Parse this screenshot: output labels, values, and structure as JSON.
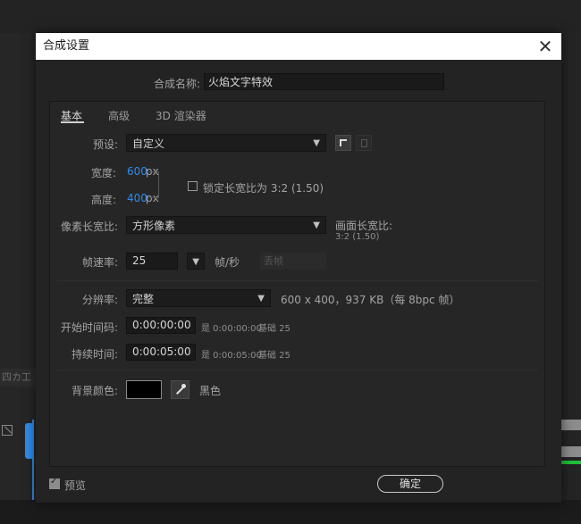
{
  "background": {
    "left_label": "四カ工"
  },
  "dialog": {
    "title": "合成设置",
    "close_glyph": "✕",
    "comp_name_label": "合成名称:",
    "comp_name_value": "火焰文字特效",
    "tabs": [
      "基本",
      "高级",
      "3D 渲染器"
    ],
    "preset": {
      "label": "预设:",
      "value": "自定义"
    },
    "width": {
      "label": "宽度:",
      "value": "600",
      "unit": "px"
    },
    "height": {
      "label": "高度:",
      "value": "400",
      "unit": "px"
    },
    "lock_aspect": {
      "label": "锁定长宽比为 3:2 (1.50)",
      "checked": false
    },
    "pixel_aspect": {
      "label": "像素长宽比:",
      "value": "方形像素"
    },
    "frame_aspect": {
      "label": "画面长宽比:",
      "value": "3:2 (1.50)"
    },
    "frame_rate": {
      "label": "帧速率:",
      "value": "25",
      "unit": "帧/秒",
      "drop_frame": "丢帧"
    },
    "resolution": {
      "label": "分辨率:",
      "value": "完整",
      "info": "600 x 400，937 KB（每 8bpc 帧）"
    },
    "start_timecode": {
      "label": "开始时间码:",
      "value": "0:00:00:00",
      "info": "是 0:00:00:00",
      "base": "基础 25"
    },
    "duration": {
      "label": "持续时间:",
      "value": "0:00:05:00",
      "info": "是 0:00:05:00",
      "base": "基础 25"
    },
    "bg_color": {
      "label": "背景颜色:",
      "name": "黑色",
      "swatch": "#000000"
    },
    "preview": {
      "label": "预览",
      "checked": true
    },
    "ok_button": "确定"
  },
  "colors": {
    "accent": "#2d8ceb",
    "green": "#1fc03a"
  }
}
